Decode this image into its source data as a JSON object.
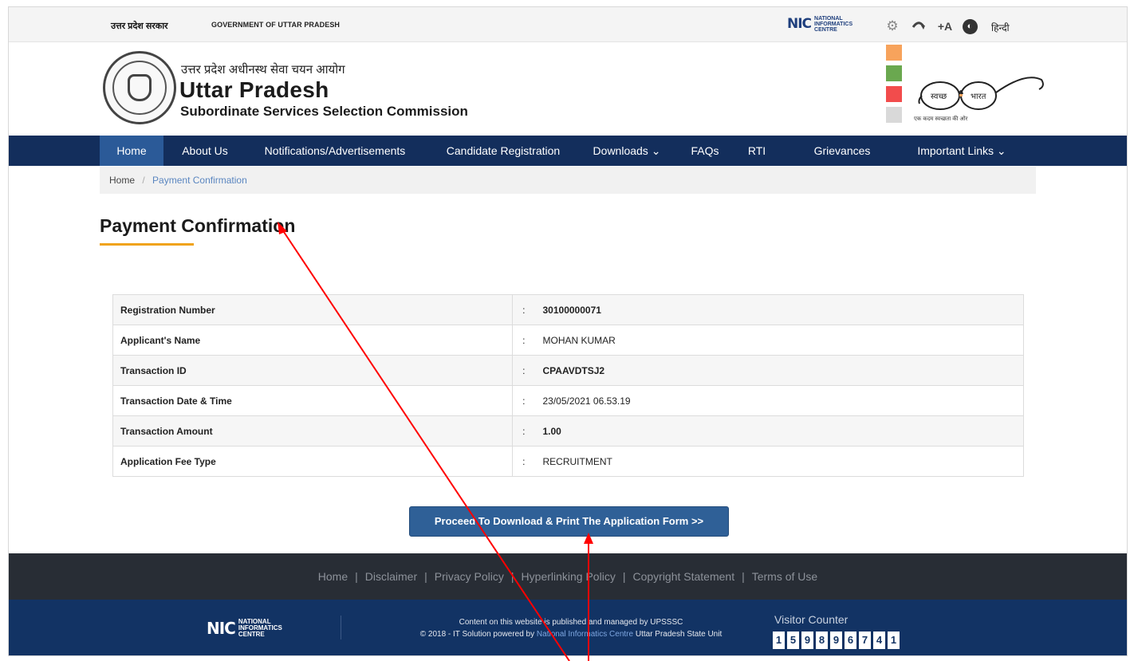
{
  "gov_strip": {
    "hindi": "उत्तर प्रदेश सरकार",
    "english": "GOVERNMENT OF UTTAR PRADESH",
    "nic_mark": "NIC",
    "nic_words": [
      "NATIONAL",
      "INFORMATICS",
      "CENTRE"
    ],
    "icons": [
      "gear-icon",
      "accessibility-icon",
      "font-size-icon",
      "contrast-icon"
    ],
    "font_size_glyph": "+A",
    "lang": "हिन्दी"
  },
  "header": {
    "hindi_name": "उत्तर प्रदेश अधीनस्थ सेवा चयन आयोग",
    "title": "Uttar Pradesh",
    "subtitle": "Subordinate Services Selection Commission",
    "theme_swatches": [
      "#f7a35c",
      "#6aa84f",
      "#f24c4c",
      "#d9d9d9"
    ],
    "swachh_left": "स्वच्छ",
    "swachh_right": "भारत",
    "swachh_caption": "एक कदम स्वच्छता की ओर"
  },
  "nav": {
    "items": [
      {
        "label": "Home"
      },
      {
        "label": "About Us"
      },
      {
        "label": "Notifications/Advertisements"
      },
      {
        "label": "Candidate Registration"
      },
      {
        "label": "Downloads ⌄"
      },
      {
        "label": "FAQs"
      },
      {
        "label": "RTI"
      },
      {
        "label": "Grievances"
      },
      {
        "label": "Important Links ⌄"
      }
    ]
  },
  "breadcrumb": {
    "home": "Home",
    "separator": "/",
    "current": "Payment Confirmation"
  },
  "page": {
    "title": "Payment Confirmation"
  },
  "details": {
    "colon": ":",
    "rows": [
      {
        "label": "Registration Number",
        "value": "30100000071"
      },
      {
        "label": "Applicant's Name",
        "value": "MOHAN KUMAR"
      },
      {
        "label": "Transaction ID",
        "value": "CPAAVDTSJ2"
      },
      {
        "label": "Transaction Date & Time",
        "value": "23/05/2021 06.53.19"
      },
      {
        "label": "Transaction Amount",
        "value": "1.00"
      },
      {
        "label": "Application Fee Type",
        "value": "RECRUITMENT"
      }
    ]
  },
  "proceed_button": "Proceed To Download & Print The Application Form >>",
  "footer": {
    "links": [
      "Home",
      "Disclaimer",
      "Privacy Policy",
      "Hyperlinking Policy",
      "Copyright Statement",
      "Terms of Use"
    ],
    "separator": "|",
    "content_line": "Content on this website is published and managed by UPSSSC",
    "copyright_prefix": "© 2018 - IT Solution powered by",
    "nic_name": "National Informatics Centre",
    "copyright_suffix": "Uttar Pradesh State Unit",
    "visitor_label": "Visitor Counter",
    "visitor_digits": [
      "1",
      "5",
      "9",
      "8",
      "9",
      "6",
      "7",
      "4",
      "1"
    ]
  },
  "colors": {
    "nav_bg": "#132e5c",
    "nav_active": "#2b5a98",
    "button_bg": "#2f6097",
    "title_underline": "#f0a31a",
    "annotation_arrow": "#ff0000"
  }
}
